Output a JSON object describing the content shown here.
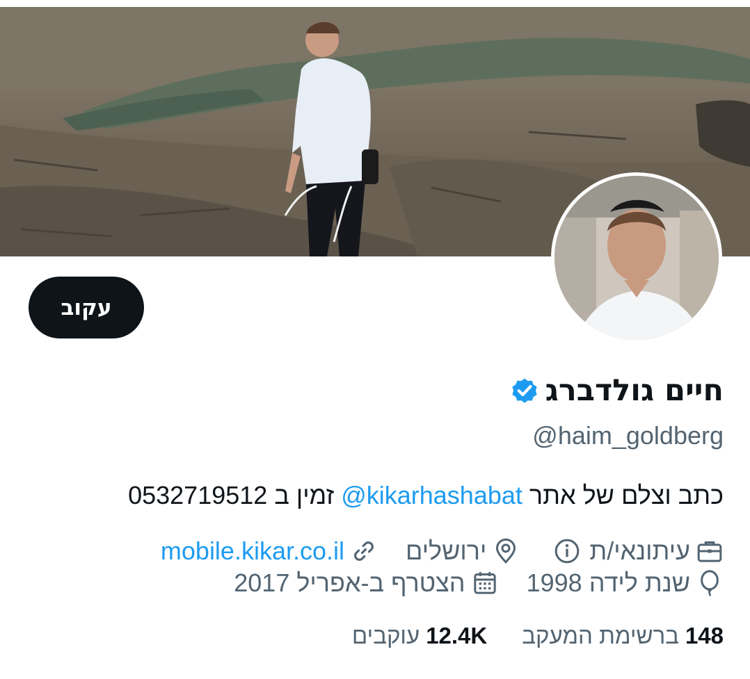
{
  "profile": {
    "name": "חיים גולדברג",
    "handle": "@haim_goldberg",
    "follow_label": "עקוב",
    "bio": {
      "before": "כתב וצלם של אתר ",
      "mention": "@kikarhashabat",
      "after": " זמין ב 0532719512"
    },
    "meta": {
      "profession": "עיתונאי/ת",
      "location": "ירושלים",
      "website": "mobile.kikar.co.il",
      "birth": "שנת לידה 1998",
      "joined": "הצטרף ב-אפריל 2017"
    },
    "stats": {
      "following_count": "148",
      "following_label": "ברשימת המעקב",
      "followers_count": "12.4K",
      "followers_label": "עוקבים"
    }
  },
  "icons": {
    "profession": "briefcase-icon",
    "info": "info-icon",
    "location": "location-pin-icon",
    "website": "link-icon",
    "birth": "balloon-icon",
    "joined": "calendar-icon",
    "verified": "verified-badge-icon"
  },
  "colors": {
    "accent": "#1d9bf0",
    "text": "#0f1419",
    "muted": "#536471",
    "button": "#0f1419"
  }
}
